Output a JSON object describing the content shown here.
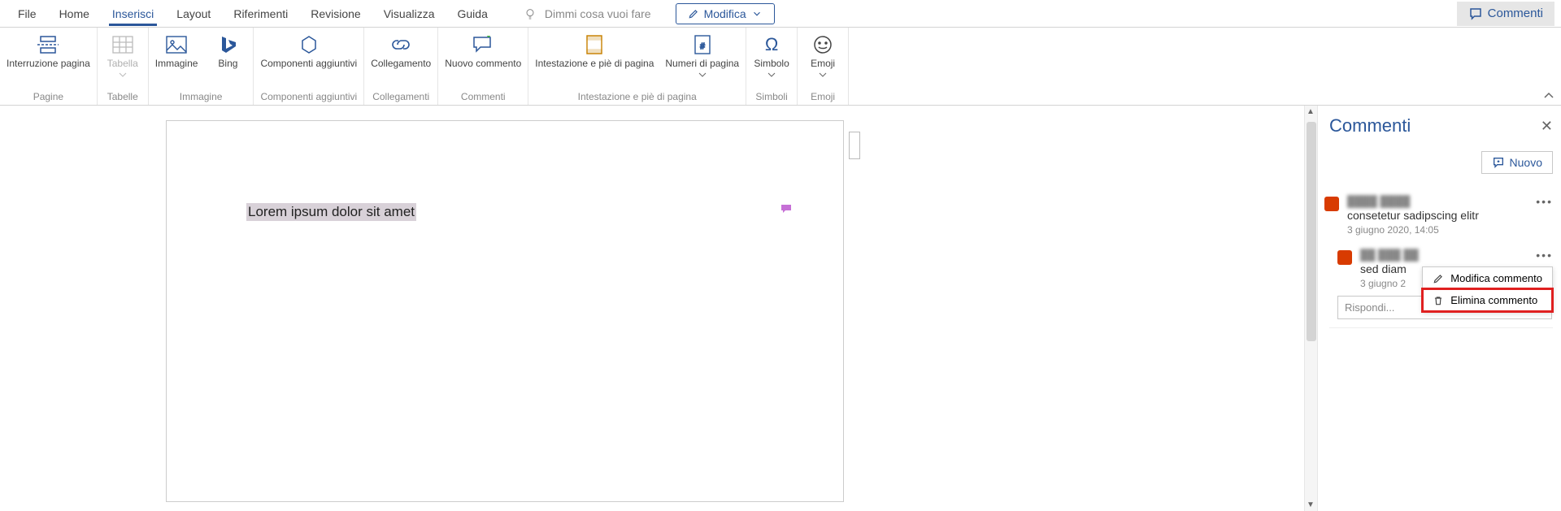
{
  "tabs": {
    "file": "File",
    "home": "Home",
    "insert": "Inserisci",
    "layout": "Layout",
    "references": "Riferimenti",
    "review": "Revisione",
    "view": "Visualizza",
    "help": "Guida"
  },
  "tellme_placeholder": "Dimmi cosa vuoi fare",
  "edit_button": "Modifica",
  "comments_button": "Commenti",
  "ribbon": {
    "pagebreak": "Interruzione pagina",
    "table": "Tabella",
    "image": "Immagine",
    "bing": "Bing",
    "addins": "Componenti aggiuntivi",
    "link": "Collegamento",
    "newcomment": "Nuovo commento",
    "headerfooter": "Intestazione e piè di pagina",
    "pagenumbers": "Numeri di pagina",
    "symbol": "Simbolo",
    "emoji": "Emoji",
    "groups": {
      "pages": "Pagine",
      "tables": "Tabelle",
      "image": "Immagine",
      "addins": "Componenti aggiuntivi",
      "links": "Collegamenti",
      "comments": "Commenti",
      "headerfooter": "Intestazione e piè di pagina",
      "symbols": "Simboli",
      "emoji": "Emoji"
    }
  },
  "doc": {
    "selected_text": "Lorem ipsum dolor sit amet"
  },
  "pane": {
    "title": "Commenti",
    "new": "Nuovo",
    "reply_placeholder": "Rispondi...",
    "menu_edit": "Modifica commento",
    "menu_delete": "Elimina commento",
    "c1": {
      "author": "████ ████",
      "body": "consetetur sadipscing elitr",
      "ts": "3 giugno 2020, 14:05"
    },
    "c2": {
      "author": "██ ███ ██",
      "body": "sed diam",
      "ts": "3 giugno 2"
    }
  }
}
